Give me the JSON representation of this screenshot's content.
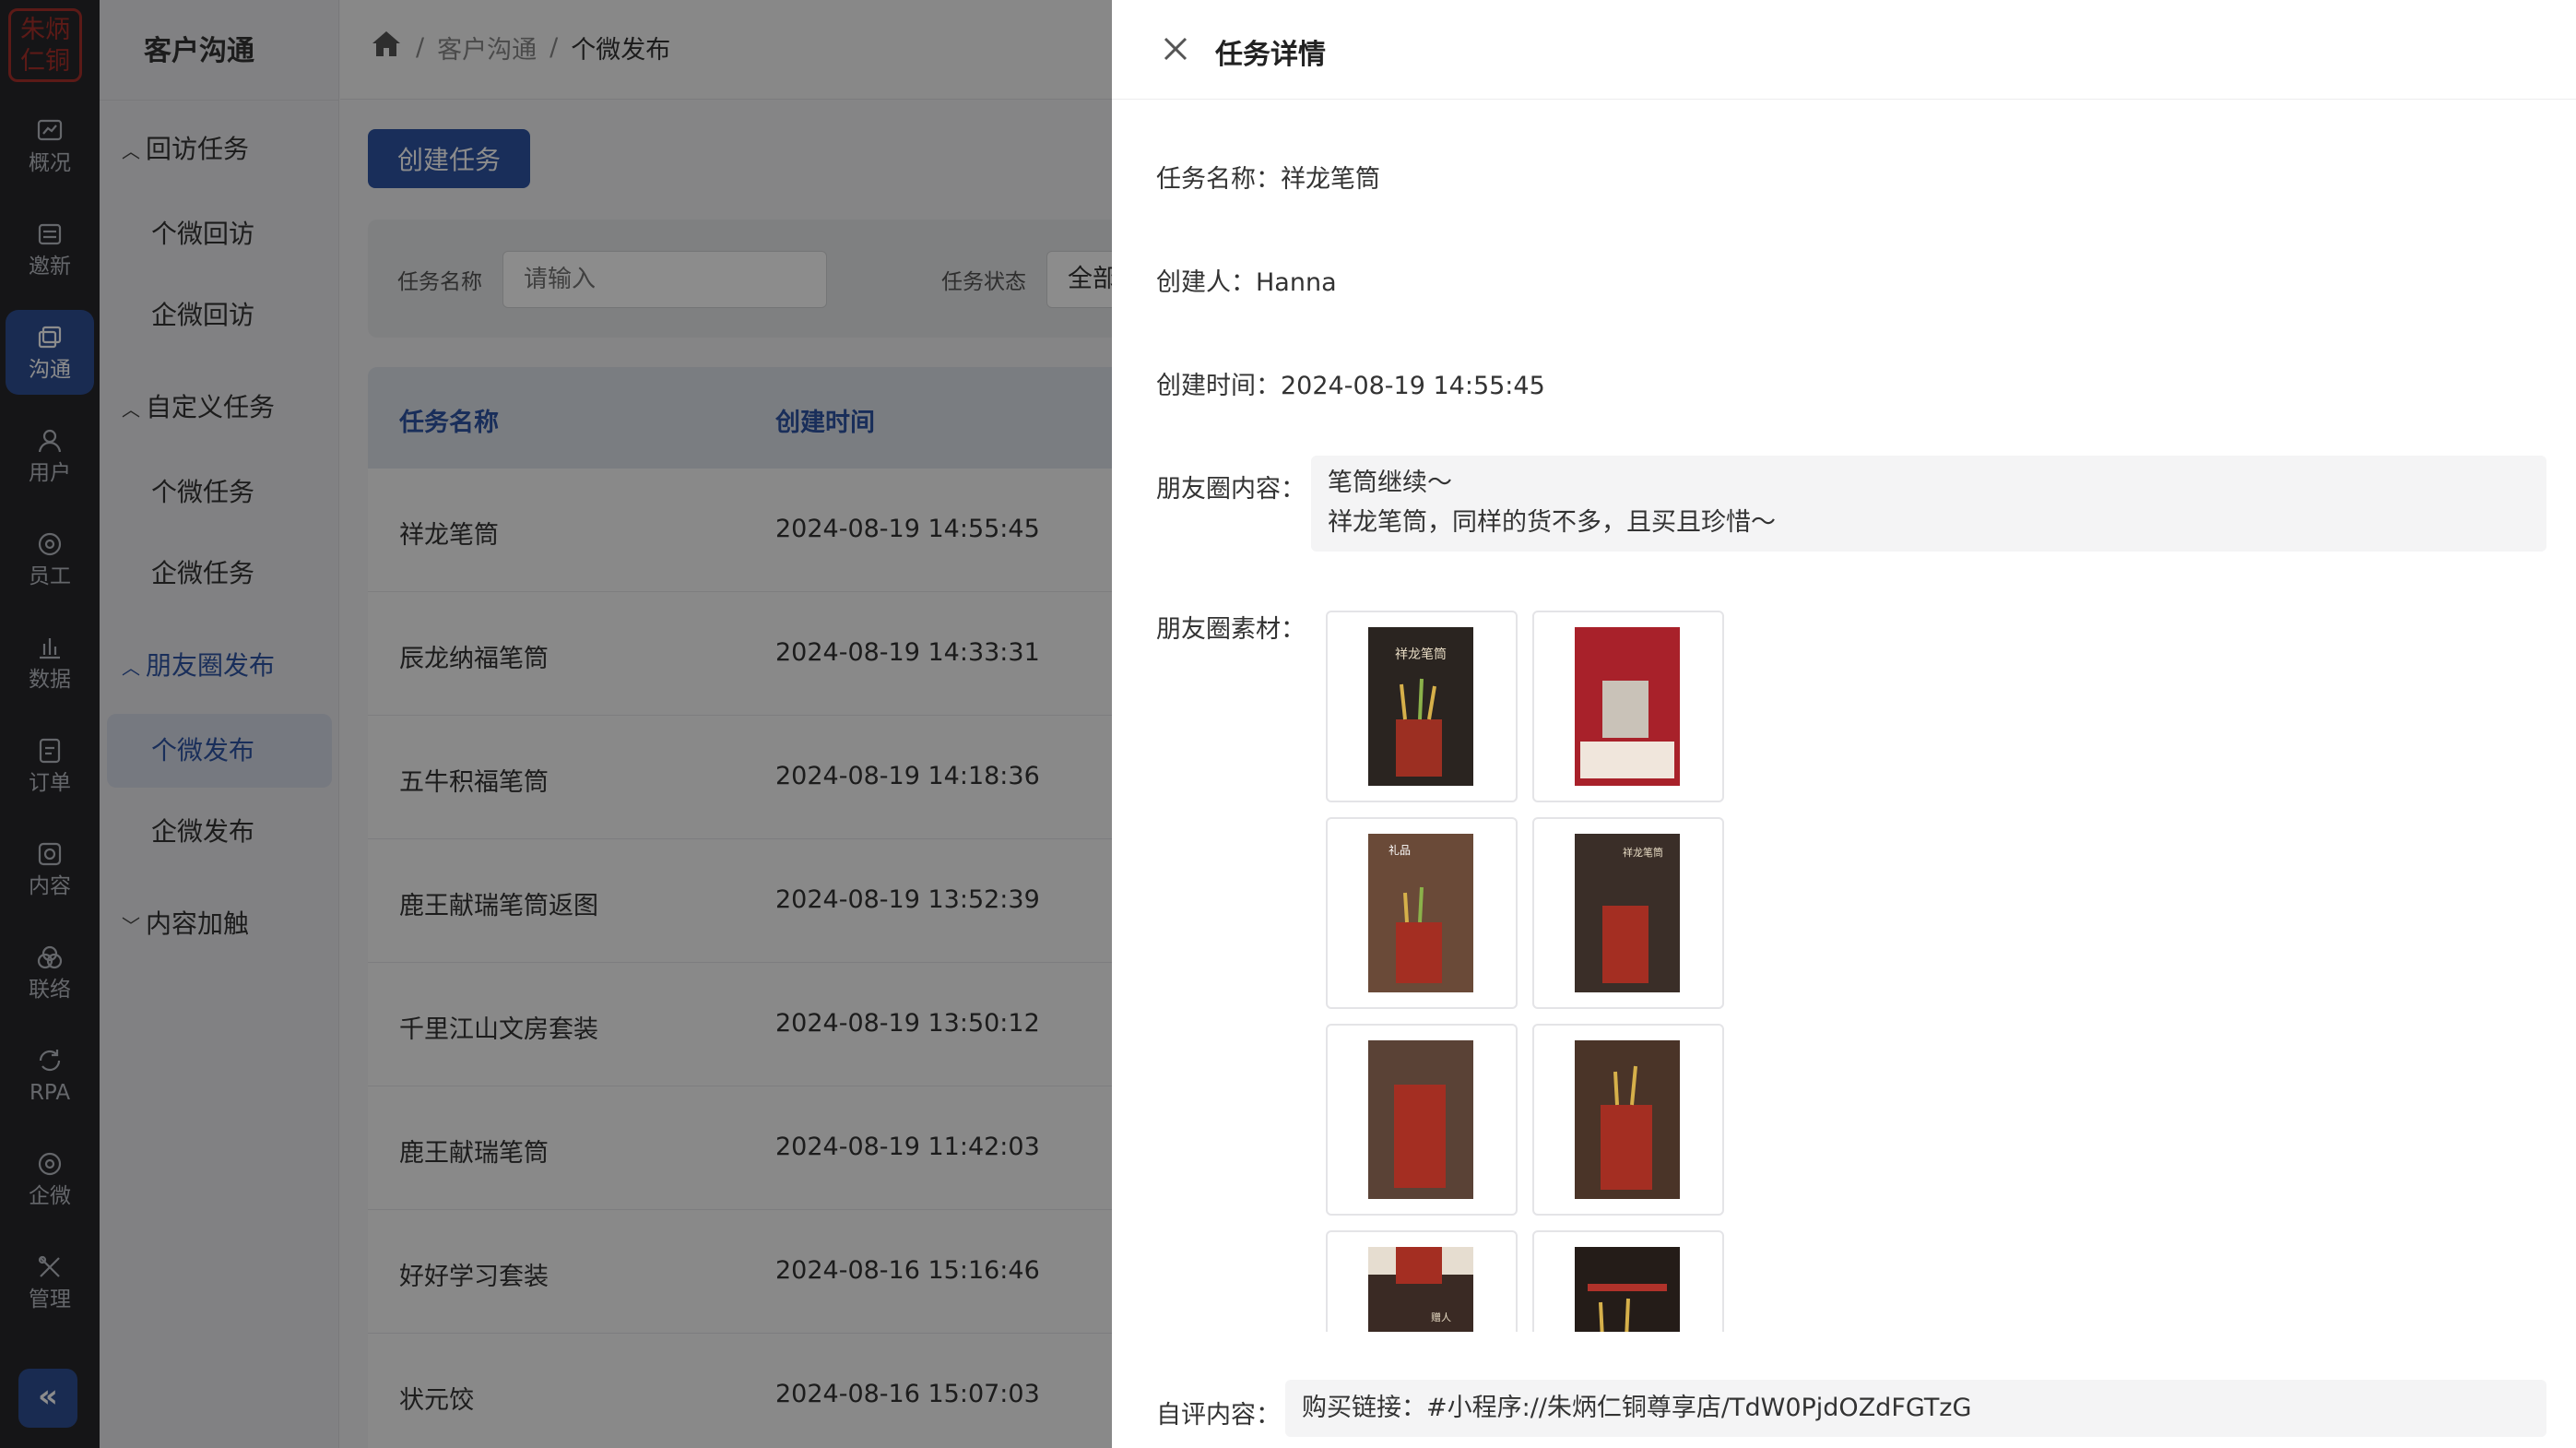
{
  "logo": {
    "text": "朱炳仁铜"
  },
  "rail": [
    {
      "label": "概况",
      "icon": "chart-icon"
    },
    {
      "label": "邀新",
      "icon": "invite-icon"
    },
    {
      "label": "沟通",
      "icon": "chat-icon",
      "active": true
    },
    {
      "label": "用户",
      "icon": "user-icon"
    },
    {
      "label": "员工",
      "icon": "staff-icon"
    },
    {
      "label": "数据",
      "icon": "bar-chart-icon"
    },
    {
      "label": "订单",
      "icon": "order-icon"
    },
    {
      "label": "内容",
      "icon": "content-icon"
    },
    {
      "label": "联络",
      "icon": "link-icon"
    },
    {
      "label": "RPA",
      "icon": "rpa-icon"
    },
    {
      "label": "企微",
      "icon": "wecom-icon"
    },
    {
      "label": "管理",
      "icon": "tools-icon"
    }
  ],
  "rail_collapse": "«",
  "subside": {
    "title": "客户沟通",
    "groups": [
      {
        "label": "回访任务",
        "items": [
          "个微回访",
          "企微回访"
        ]
      },
      {
        "label": "自定义任务",
        "items": [
          "个微任务",
          "企微任务"
        ]
      },
      {
        "label": "朋友圈发布",
        "items": [
          "个微发布",
          "企微发布"
        ],
        "active_item": "个微发布"
      },
      {
        "label": "内容加触",
        "items": []
      }
    ]
  },
  "breadcrumb": {
    "items": [
      "客户沟通",
      "个微发布"
    ],
    "sep": "/"
  },
  "toolbar": {
    "create_label": "创建任务"
  },
  "filter": {
    "name_label": "任务名称",
    "name_placeholder": "请输入",
    "status_label": "任务状态",
    "status_value": "全部"
  },
  "table": {
    "headers": [
      "任务名称",
      "创建时间"
    ],
    "rows": [
      [
        "祥龙笔筒",
        "2024-08-19 14:55:45"
      ],
      [
        "辰龙纳福笔筒",
        "2024-08-19 14:33:31"
      ],
      [
        "五牛积福笔筒",
        "2024-08-19 14:18:36"
      ],
      [
        "鹿王献瑞笔筒返图",
        "2024-08-19 13:52:39"
      ],
      [
        "千里江山文房套装",
        "2024-08-19 13:50:12"
      ],
      [
        "鹿王献瑞笔筒",
        "2024-08-19 11:42:03"
      ],
      [
        "好好学习套装",
        "2024-08-16 15:16:46"
      ],
      [
        "状元饺",
        "2024-08-16 15:07:03"
      ]
    ]
  },
  "drawer": {
    "title": "任务详情",
    "task_name_label": "任务名称：",
    "task_name": "祥龙笔筒",
    "creator_label": "创建人：",
    "creator": "Hanna",
    "created_label": "创建时间：",
    "created": "2024-08-19 14:55:45",
    "moments_label": "朋友圈内容：",
    "moments_line1": "笔筒继续～",
    "moments_line2": "祥龙笔筒，同样的货不多，且买且珍惜～",
    "material_label": "朋友圈素材：",
    "comment_label": "自评内容：",
    "comment": "购买链接：#小程序://朱炳仁铜尊享店/TdW0PjdOZdFGTzG"
  },
  "thumb_texts": [
    "祥龙笔筒",
    "礼品",
    "祥龙笔筒",
    "赠人"
  ]
}
